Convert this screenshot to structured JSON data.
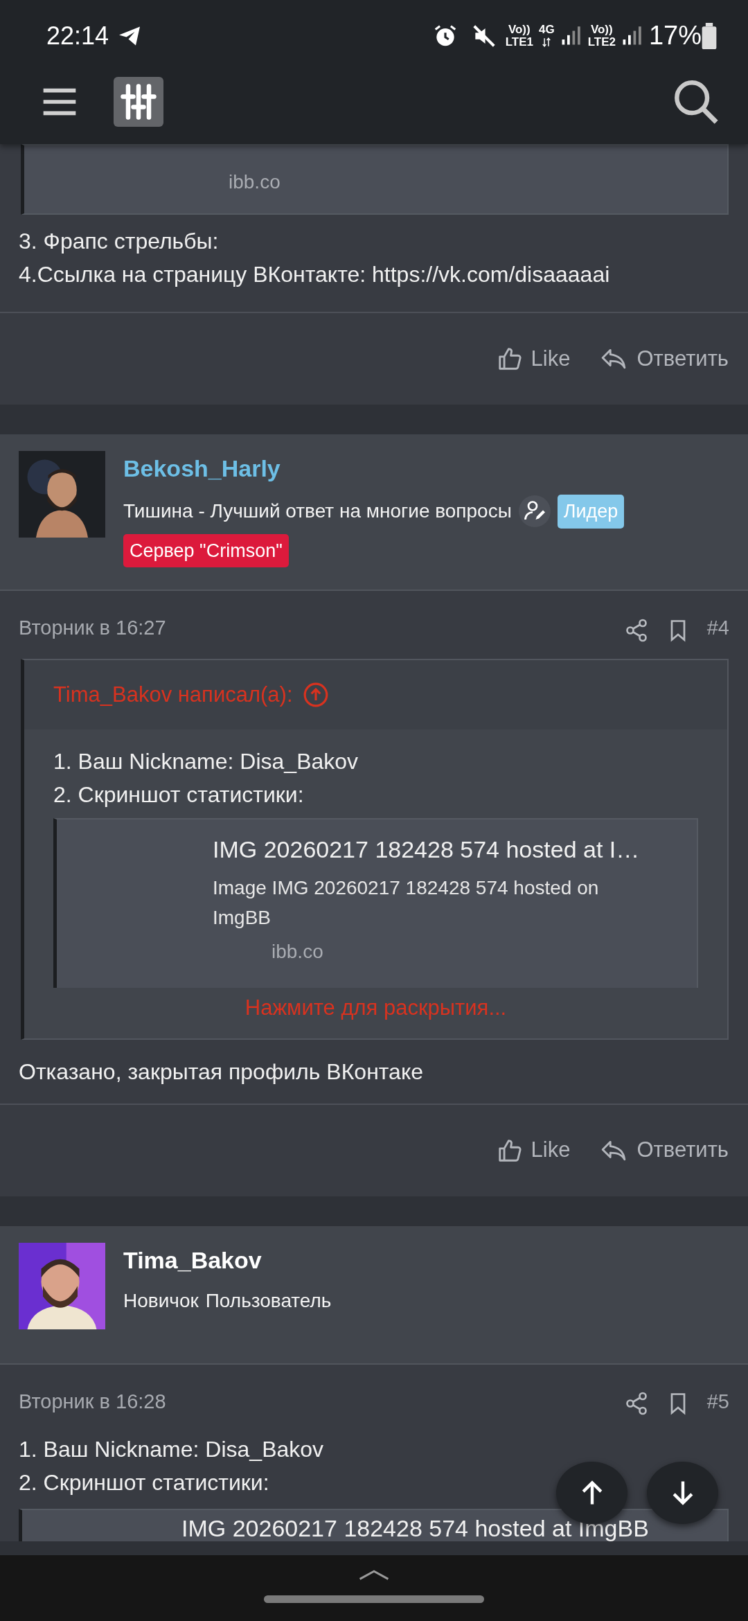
{
  "status_bar": {
    "time": "22:14",
    "indicators": [
      "Vo))",
      "LTE1",
      "4G",
      "Vo))",
      "LTE2"
    ],
    "battery": "17%"
  },
  "previous_post": {
    "embed": {
      "site": "ibb.co"
    },
    "lines": [
      "3. Фрапс стрельбы:",
      "4.Ссылка на страницу ВКонтакте: https://vk.com/disaaaaai"
    ],
    "actions": [
      {
        "kind": "like",
        "label": "Like"
      },
      {
        "kind": "reply",
        "label": "Ответить"
      }
    ]
  },
  "posts": [
    {
      "author": {
        "name": "Bekosh_Harly",
        "color": "#6dbfe6",
        "lines": [
          [
            {
              "kind": "title",
              "text": "Тишина - Лучший ответ на многие вопросы"
            },
            {
              "kind": "editor"
            },
            {
              "kind": "banner",
              "text": "Лидер",
              "color": "#84c8ea"
            }
          ],
          [
            {
              "kind": "banner",
              "text": "Сервер \"Crimson\"",
              "color": "#dc1a3c"
            }
          ]
        ]
      },
      "date": "Вторник в 16:27",
      "number": "#4",
      "body": [
        {
          "kind": "quote",
          "attribution": "Tima_Bakov написал(а):",
          "lines": [
            "1. Ваш Nickname: Disa_Bakov",
            "2. Скриншот статистики:"
          ],
          "embed": {
            "title": "IMG 20260217 182428 574 hosted at I…",
            "description": "Image IMG 20260217 182428 574 hosted on ImgBB",
            "site": "ibb.co"
          },
          "expand": "Нажмите для раскрытия..."
        },
        {
          "kind": "text",
          "text": "Отказано, закрытая профиль ВКонтаке"
        }
      ],
      "actions": [
        {
          "kind": "like",
          "label": "Like"
        },
        {
          "kind": "reply",
          "label": "Ответить"
        }
      ]
    },
    {
      "author": {
        "name": "Tima_Bakov",
        "color": "#ffffff",
        "lines": [
          [
            {
              "kind": "title",
              "text": "Новичок"
            },
            {
              "kind": "title",
              "text": "Пользователь"
            }
          ]
        ]
      },
      "date": "Вторник в 16:28",
      "number": "#5",
      "body": [
        {
          "kind": "text",
          "text": "1. Ваш Nickname: Disa_Bakov"
        },
        {
          "kind": "text",
          "text": "2. Скриншот статистики:"
        },
        {
          "kind": "embed",
          "embed": {
            "title": "IMG 20260217 182428 574 hosted at ImgBB"
          }
        }
      ]
    }
  ]
}
